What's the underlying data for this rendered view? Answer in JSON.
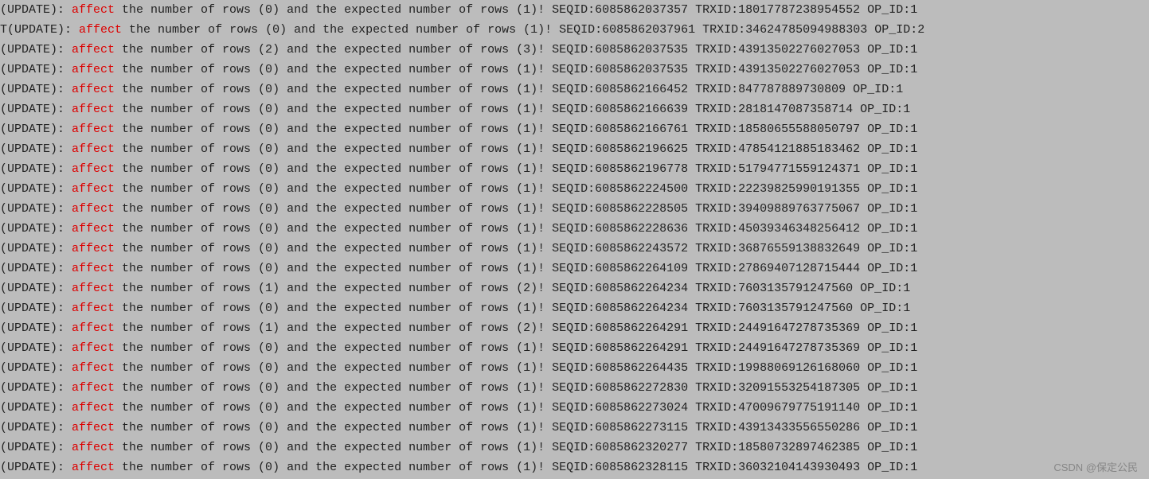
{
  "highlight_word": "affect",
  "log_template": {
    "prefix_update": "(UPDATE): ",
    "prefix_it_update": "T(UPDATE): ",
    "mid1": " the number of rows (",
    "mid2": ") and the expected number of rows (",
    "mid3": ")! SEQID:",
    "mid_trx": " TRXID:",
    "mid_op": " OP_ID:"
  },
  "lines": [
    {
      "prefix": "(UPDATE): ",
      "actual": 0,
      "expected": 1,
      "seqid": "6085862037357",
      "trxid": "18017787238954552",
      "opid": 1
    },
    {
      "prefix": "T(UPDATE): ",
      "actual": 0,
      "expected": 1,
      "seqid": "6085862037961",
      "trxid": "34624785094988303",
      "opid": 2
    },
    {
      "prefix": "(UPDATE): ",
      "actual": 2,
      "expected": 3,
      "seqid": "6085862037535",
      "trxid": "43913502276027053",
      "opid": 1
    },
    {
      "prefix": "(UPDATE): ",
      "actual": 0,
      "expected": 1,
      "seqid": "6085862037535",
      "trxid": "43913502276027053",
      "opid": 1
    },
    {
      "prefix": "(UPDATE): ",
      "actual": 0,
      "expected": 1,
      "seqid": "6085862166452",
      "trxid": "847787889730809",
      "opid": 1
    },
    {
      "prefix": "(UPDATE): ",
      "actual": 0,
      "expected": 1,
      "seqid": "6085862166639",
      "trxid": "2818147087358714",
      "opid": 1
    },
    {
      "prefix": "(UPDATE): ",
      "actual": 0,
      "expected": 1,
      "seqid": "6085862166761",
      "trxid": "18580655588050797",
      "opid": 1
    },
    {
      "prefix": "(UPDATE): ",
      "actual": 0,
      "expected": 1,
      "seqid": "6085862196625",
      "trxid": "47854121885183462",
      "opid": 1
    },
    {
      "prefix": "(UPDATE): ",
      "actual": 0,
      "expected": 1,
      "seqid": "6085862196778",
      "trxid": "51794771559124371",
      "opid": 1
    },
    {
      "prefix": "(UPDATE): ",
      "actual": 0,
      "expected": 1,
      "seqid": "6085862224500",
      "trxid": "22239825990191355",
      "opid": 1
    },
    {
      "prefix": "(UPDATE): ",
      "actual": 0,
      "expected": 1,
      "seqid": "6085862228505",
      "trxid": "39409889763775067",
      "opid": 1
    },
    {
      "prefix": "(UPDATE): ",
      "actual": 0,
      "expected": 1,
      "seqid": "6085862228636",
      "trxid": "45039346348256412",
      "opid": 1
    },
    {
      "prefix": "(UPDATE): ",
      "actual": 0,
      "expected": 1,
      "seqid": "6085862243572",
      "trxid": "36876559138832649",
      "opid": 1
    },
    {
      "prefix": "(UPDATE): ",
      "actual": 0,
      "expected": 1,
      "seqid": "6085862264109",
      "trxid": "27869407128715444",
      "opid": 1
    },
    {
      "prefix": "(UPDATE): ",
      "actual": 1,
      "expected": 2,
      "seqid": "6085862264234",
      "trxid": "7603135791247560",
      "opid": 1
    },
    {
      "prefix": "(UPDATE): ",
      "actual": 0,
      "expected": 1,
      "seqid": "6085862264234",
      "trxid": "7603135791247560",
      "opid": 1
    },
    {
      "prefix": "(UPDATE): ",
      "actual": 1,
      "expected": 2,
      "seqid": "6085862264291",
      "trxid": "24491647278735369",
      "opid": 1
    },
    {
      "prefix": "(UPDATE): ",
      "actual": 0,
      "expected": 1,
      "seqid": "6085862264291",
      "trxid": "24491647278735369",
      "opid": 1
    },
    {
      "prefix": "(UPDATE): ",
      "actual": 0,
      "expected": 1,
      "seqid": "6085862264435",
      "trxid": "19988069126168060",
      "opid": 1
    },
    {
      "prefix": "(UPDATE): ",
      "actual": 0,
      "expected": 1,
      "seqid": "6085862272830",
      "trxid": "32091553254187305",
      "opid": 1
    },
    {
      "prefix": "(UPDATE): ",
      "actual": 0,
      "expected": 1,
      "seqid": "6085862273024",
      "trxid": "47009679775191140",
      "opid": 1
    },
    {
      "prefix": "(UPDATE): ",
      "actual": 0,
      "expected": 1,
      "seqid": "6085862273115",
      "trxid": "43913433556550286",
      "opid": 1
    },
    {
      "prefix": "(UPDATE): ",
      "actual": 0,
      "expected": 1,
      "seqid": "6085862320277",
      "trxid": "18580732897462385",
      "opid": 1
    },
    {
      "prefix": "(UPDATE): ",
      "actual": 0,
      "expected": 1,
      "seqid": "6085862328115",
      "trxid": "36032104143930493",
      "opid": 1
    }
  ],
  "watermark": "CSDN @保定公民"
}
